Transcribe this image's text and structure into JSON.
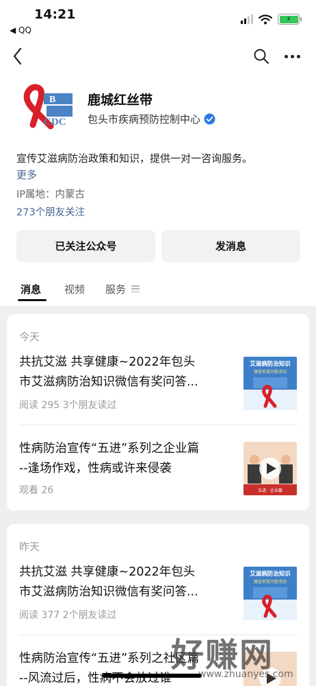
{
  "status_bar": {
    "time": "14:21",
    "back_app": "◀ QQ"
  },
  "account": {
    "name": "鹿城红丝带",
    "org": "包头市疾病预防控制中心",
    "logo_text": "CDC",
    "description": "宣传艾滋病防治政策和知识，提供一对一咨询服务。",
    "more_label": "更多",
    "ip_location": "IP属地：内蒙古",
    "followers": "273个朋友关注"
  },
  "buttons": {
    "followed": "已关注公众号",
    "message": "发消息"
  },
  "tabs": [
    "消息",
    "视频",
    "服务"
  ],
  "feed": {
    "today": {
      "label": "今天",
      "articles": [
        {
          "title_line1": "共抗艾滋 共享健康~2022年包头",
          "title_line2": "市艾滋病防治知识微信有奖问答...",
          "meta": "阅读 295  3个朋友读过",
          "thumb_title": "艾滋病防治知识",
          "thumb_subtitle": "微信有奖问答活动"
        },
        {
          "title_line1": "性病防治宣传“五进”系列之企业篇",
          "title_line2": "--逢场作戏，性病或许来侵袭",
          "meta": "观看 26",
          "thumb_caption": "五进 · 企业篇"
        }
      ]
    },
    "yesterday": {
      "label": "昨天",
      "articles": [
        {
          "title_line1": "共抗艾滋 共享健康~2022年包头",
          "title_line2": "市艾滋病防治知识微信有奖问答...",
          "meta": "阅读 377  2个朋友读过",
          "thumb_title": "艾滋病防治知识",
          "thumb_subtitle": "微信有奖问答活动"
        },
        {
          "title_line1": "性病防治宣传“五进”系列之社区篇",
          "title_line2": "--风流过后，性病不会放过谁"
        }
      ]
    }
  },
  "watermark": {
    "big": "好赚网",
    "small": "www.zhuanyes.com"
  },
  "colors": {
    "link": "#4a6694",
    "verified": "#2c7be5",
    "feed_bg": "#efefef"
  }
}
